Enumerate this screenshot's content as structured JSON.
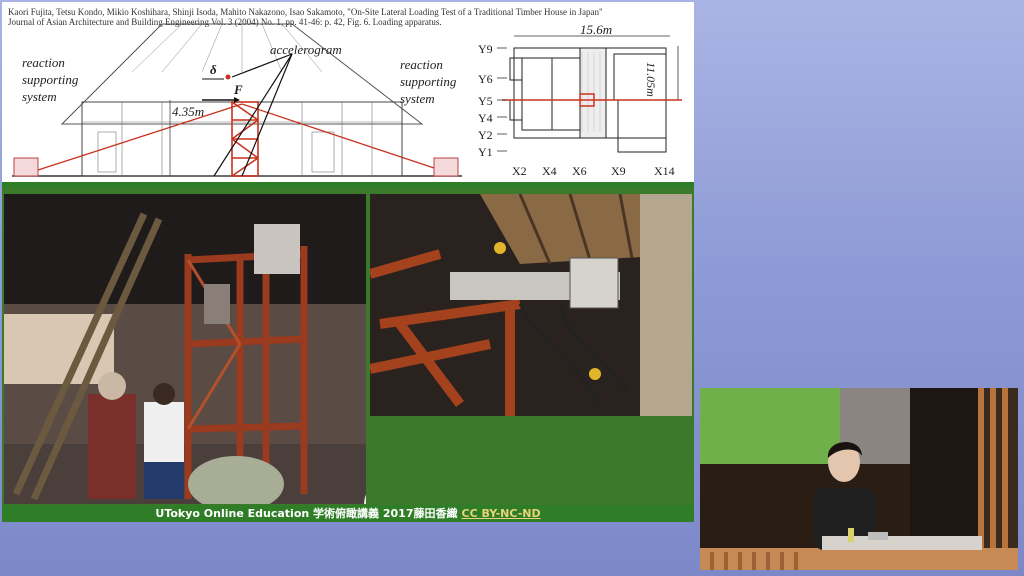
{
  "slide": {
    "citation": {
      "line1": "Kaori Fujita, Tetsu Kondo, Mikio Koshihara, Shinji Isoda, Mahito Nakazono, Isao Sakamoto, \"On-Site Lateral Loading Test of a Traditional Timber House in Japan\"",
      "line2": "Journal of Asian Architecture and Building Engineering Vol. 3 (2004) No. 1, pp. 41-46: p. 42, Fig. 6. Loading apparatus."
    },
    "drawing": {
      "left_label": "reaction\nsupporting\nsystem",
      "right_label": "reaction\nsupporting\nsystem",
      "accelerogram": "accelerogram",
      "delta": "δ",
      "force": "F",
      "height": "4.35m"
    },
    "plan": {
      "width": "15.6m",
      "depth": "11.05m",
      "y_axes": [
        "Y9",
        "Y6",
        "Y5",
        "Y4",
        "Y2",
        "Y1"
      ],
      "x_axes": [
        "X2",
        "X4",
        "X6",
        "X9",
        "X14"
      ]
    },
    "footer": {
      "text": "UTokyo Online Education 学術俯瞰講義 2017藤田香織",
      "license": "CC BY-NC-ND"
    }
  },
  "colors": {
    "accent_green": "#2f7d26",
    "frame_red": "#c8321e",
    "license_gold": "#e8d37a"
  }
}
